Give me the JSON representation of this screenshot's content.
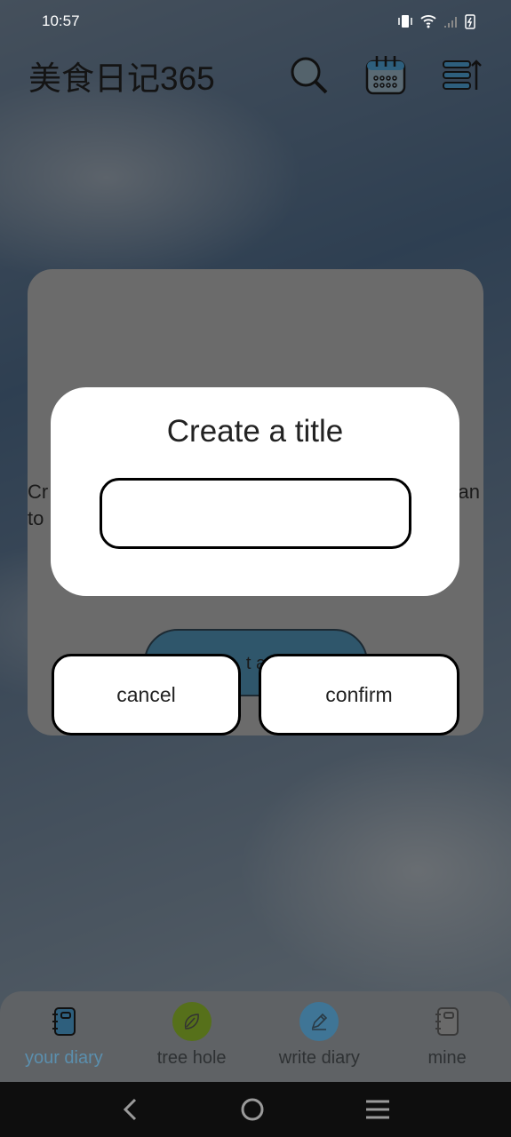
{
  "status_bar": {
    "time": "10:57"
  },
  "header": {
    "title": "美食日记365"
  },
  "card": {
    "text_fragments": [
      "Cr",
      "an",
      "to"
    ],
    "button_fragment": "t a"
  },
  "dialog": {
    "title": "Create a title",
    "input_value": "",
    "cancel_label": "cancel",
    "confirm_label": "confirm"
  },
  "bottom_nav": {
    "items": [
      {
        "label": "your diary",
        "active": true
      },
      {
        "label": "tree hole"
      },
      {
        "label": "write diary"
      },
      {
        "label": "mine"
      }
    ]
  },
  "colors": {
    "active_tab": "#5b8fae",
    "tree_hole": "#6b8a1c",
    "write_diary": "#4f8fb8",
    "card_button": "#2f566b"
  }
}
